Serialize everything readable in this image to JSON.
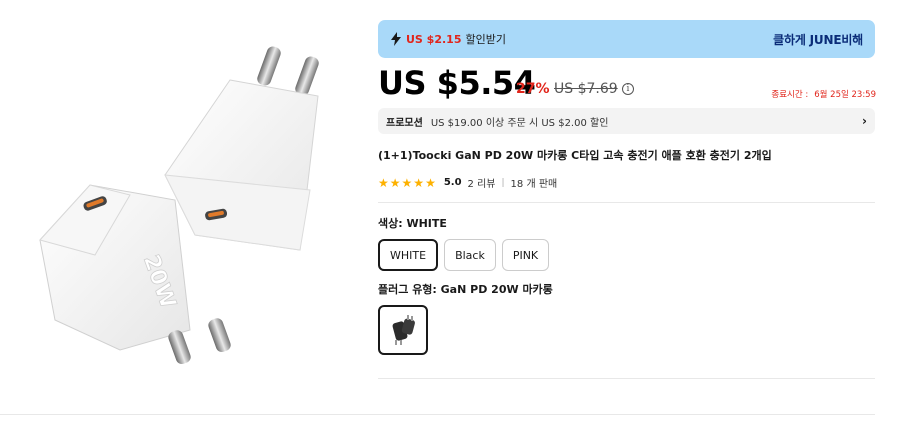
{
  "coupon": {
    "amount": "US $2.15",
    "label": "할인받기",
    "code": "클하게 JUNE비해"
  },
  "price": {
    "current": "US $5.54",
    "discount": "27%",
    "original": "US $7.69",
    "deadline_label": "종료시간 :",
    "deadline_value": "6월 25일 23:59"
  },
  "promotion": {
    "tag": "프로모션",
    "text": "US $19.00 이상 주문 시 US $2.00 할인"
  },
  "product": {
    "title": "(1+1)Toocki GaN PD 20W 마카롱 C타입 고속 충전기 애플 호환 충전기 2개입",
    "rating": "5.0",
    "reviews": "2 리뷰",
    "separator": "|",
    "sold": "18 개 판매",
    "stars": 5
  },
  "options": {
    "color_label": "색상: WHITE",
    "colors": [
      "WHITE",
      "Black",
      "PINK"
    ],
    "selected_color": "WHITE",
    "plug_label": "플러그 유형: GaN PD 20W 마카롱"
  },
  "image": {
    "badge": "20W"
  },
  "colors": {
    "accent_red": "#e1251b",
    "banner_blue": "#a9d9f9",
    "star_yellow": "#fdb100"
  }
}
